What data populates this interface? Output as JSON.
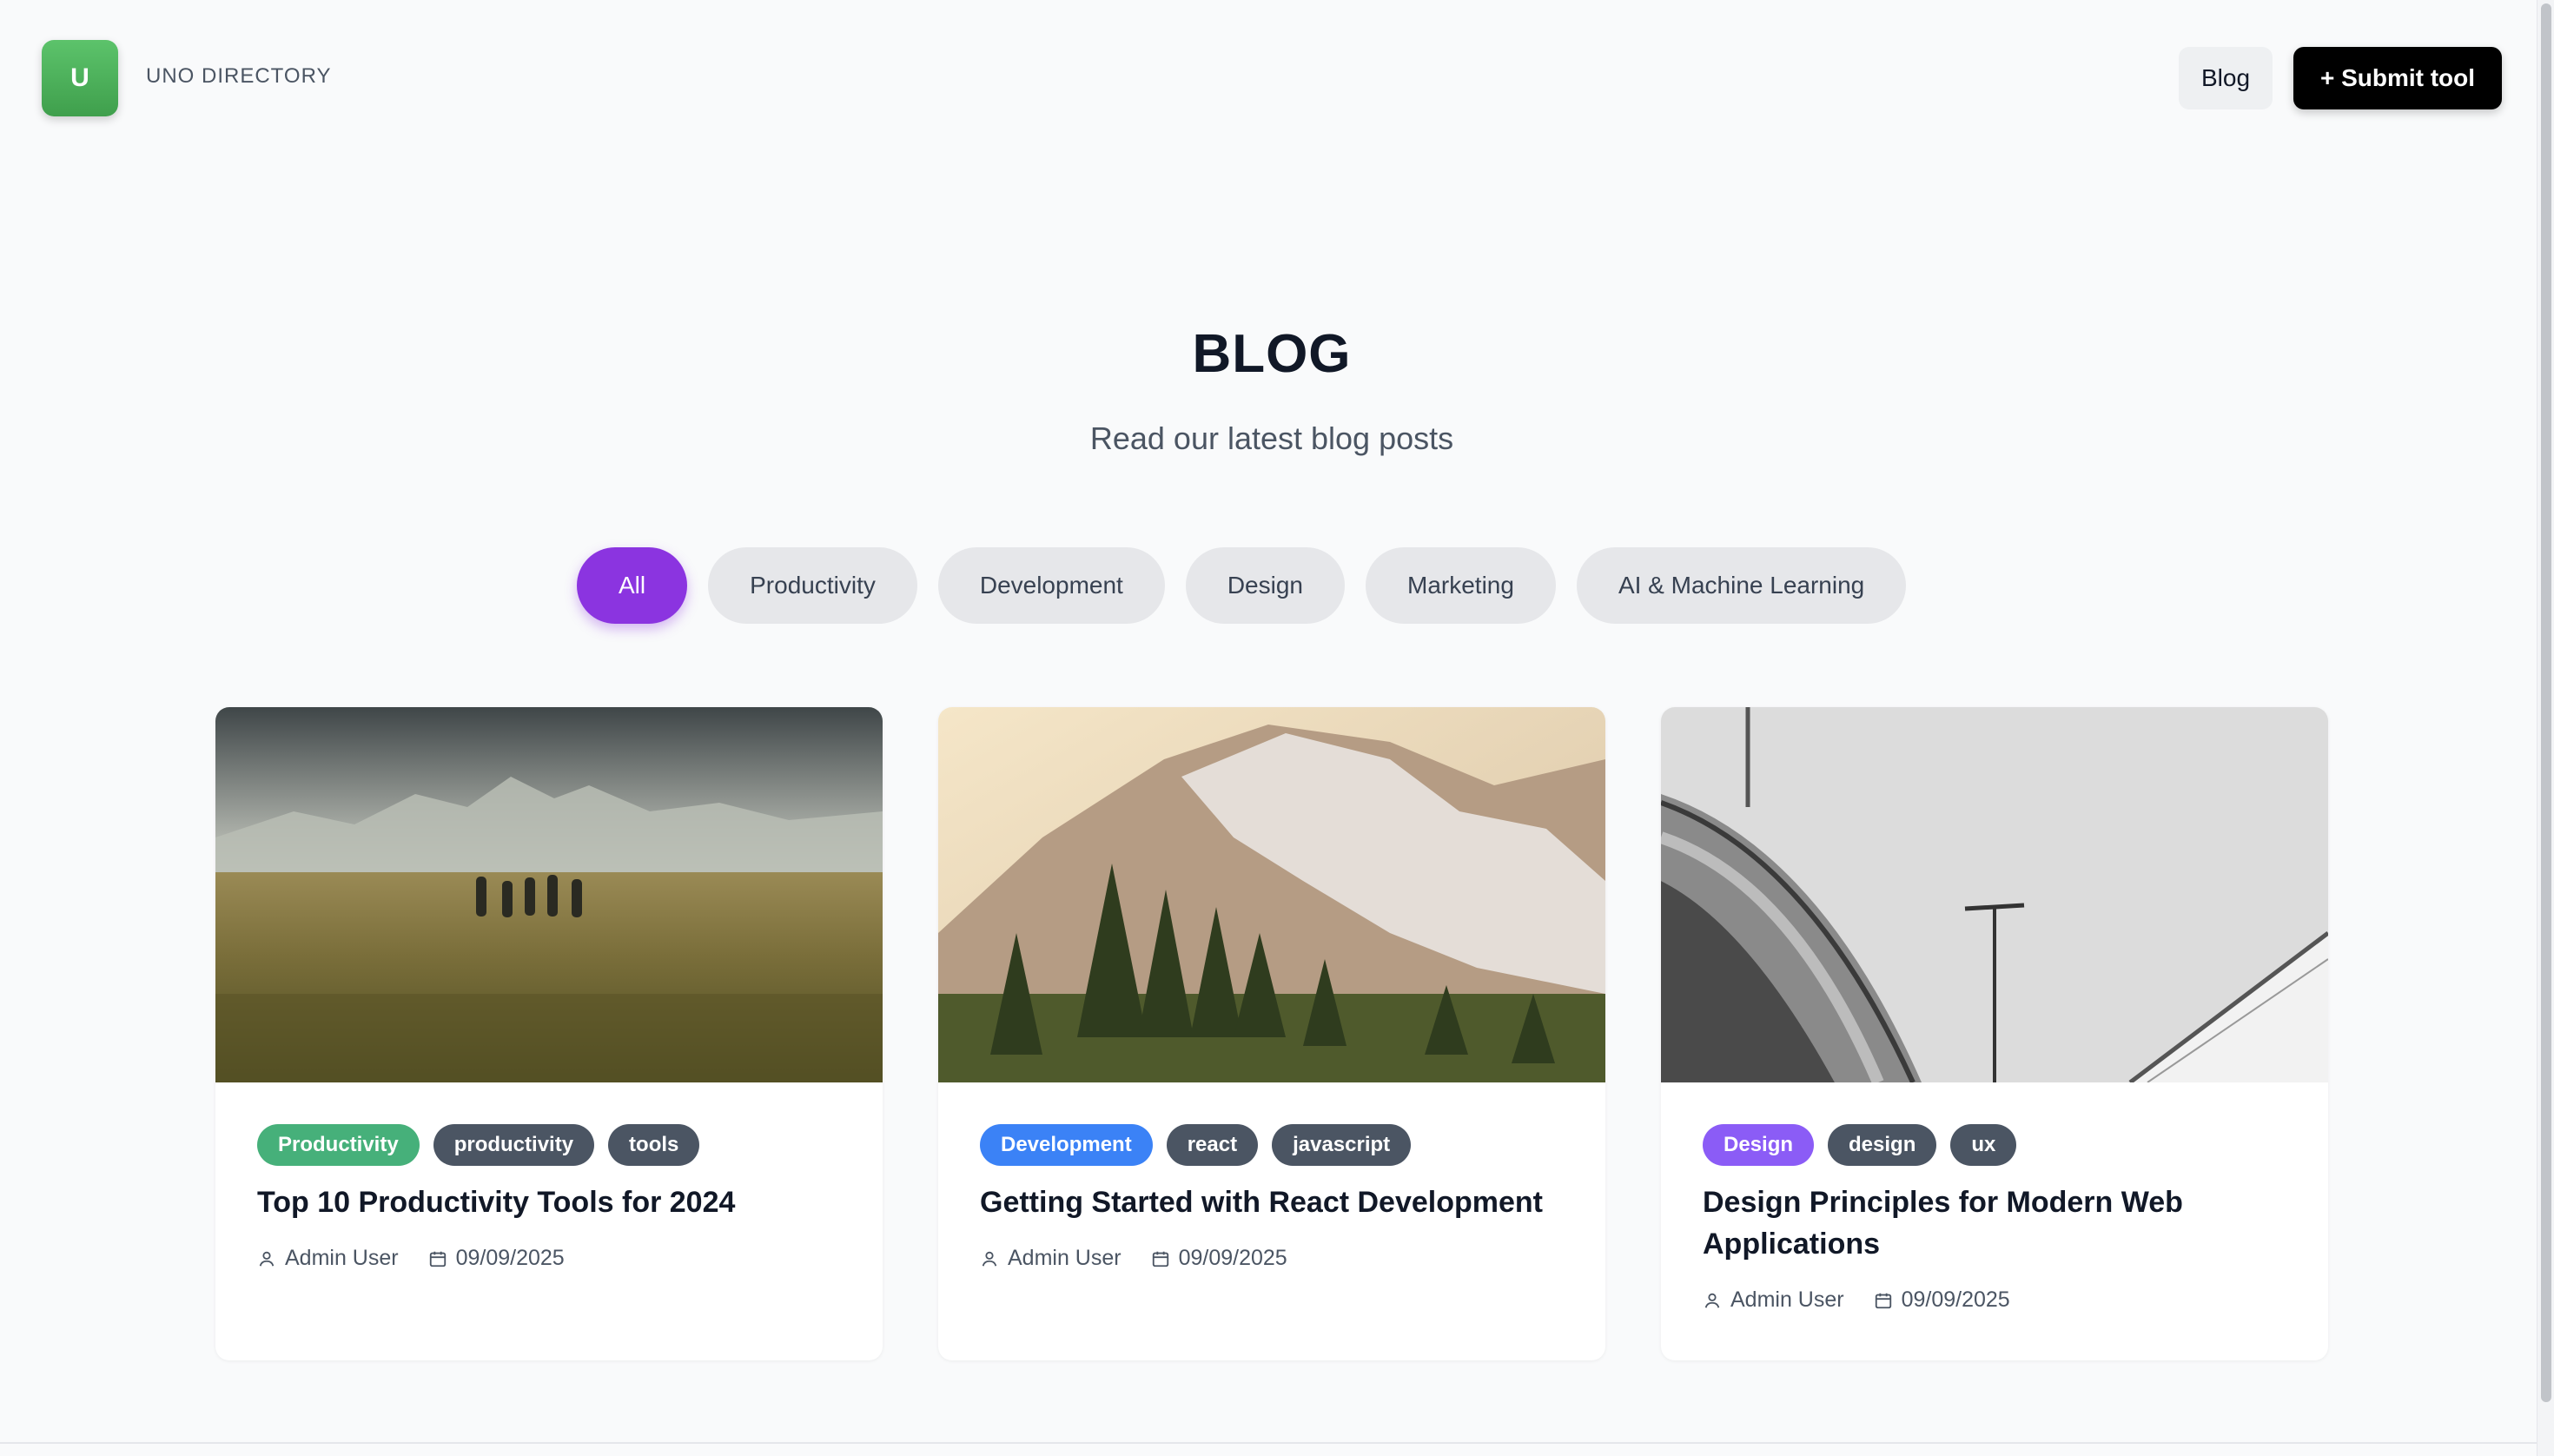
{
  "header": {
    "logo_letter": "U",
    "brand": "UNO DIRECTORY",
    "nav_blog": "Blog",
    "submit_label": "+ Submit tool"
  },
  "hero": {
    "title": "BLOG",
    "subtitle": "Read our latest blog posts"
  },
  "filters": [
    {
      "label": "All",
      "active": true
    },
    {
      "label": "Productivity",
      "active": false
    },
    {
      "label": "Development",
      "active": false
    },
    {
      "label": "Design",
      "active": false
    },
    {
      "label": "Marketing",
      "active": false
    },
    {
      "label": "AI & Machine Learning",
      "active": false
    }
  ],
  "posts": [
    {
      "category": "Productivity",
      "category_color": "#46b07a",
      "tags": [
        "productivity",
        "tools"
      ],
      "title": "Top 10 Productivity Tools for 2024",
      "author": "Admin User",
      "date": "09/09/2025",
      "image": "grassland-hikers-mountains"
    },
    {
      "category": "Development",
      "category_color": "#3b82f6",
      "tags": [
        "react",
        "javascript"
      ],
      "title": "Getting Started with React Development",
      "author": "Admin User",
      "date": "09/09/2025",
      "image": "snowy-mountain-pine-trees"
    },
    {
      "category": "Design",
      "category_color": "#8b5cf6",
      "tags": [
        "design",
        "ux"
      ],
      "title": "Design Principles for Modern Web Applications",
      "author": "Admin User",
      "date": "09/09/2025",
      "image": "black-white-architecture"
    }
  ],
  "icons": {
    "author": "user-icon",
    "date": "calendar-icon"
  }
}
